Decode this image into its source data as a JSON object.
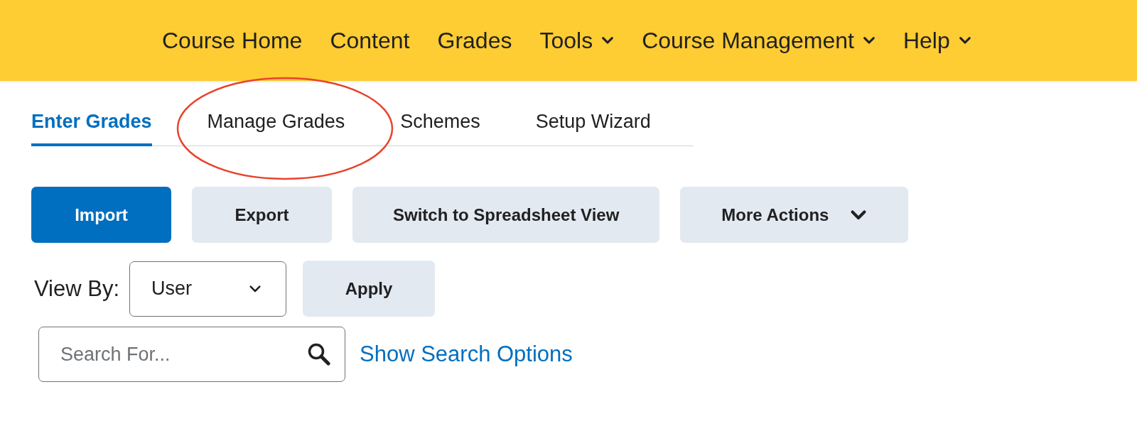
{
  "nav": {
    "items": [
      {
        "label": "Course Home",
        "dropdown": false
      },
      {
        "label": "Content",
        "dropdown": false
      },
      {
        "label": "Grades",
        "dropdown": false
      },
      {
        "label": "Tools",
        "dropdown": true
      },
      {
        "label": "Course Management",
        "dropdown": true
      },
      {
        "label": "Help",
        "dropdown": true
      }
    ]
  },
  "tabs": [
    {
      "label": "Enter Grades",
      "selected": true,
      "circled": false
    },
    {
      "label": "Manage Grades",
      "selected": false,
      "circled": true
    },
    {
      "label": "Schemes",
      "selected": false,
      "circled": false
    },
    {
      "label": "Setup Wizard",
      "selected": false,
      "circled": false
    }
  ],
  "actions": [
    {
      "label": "Import",
      "kind": "primary"
    },
    {
      "label": "Export",
      "kind": "secondary"
    },
    {
      "label": "Switch to Spreadsheet View",
      "kind": "secondary"
    },
    {
      "label": "More Actions",
      "kind": "menu"
    }
  ],
  "view_by": {
    "label": "View By:",
    "value": "User",
    "apply": "Apply"
  },
  "search": {
    "placeholder": "Search For...",
    "link": "Show Search Options"
  }
}
